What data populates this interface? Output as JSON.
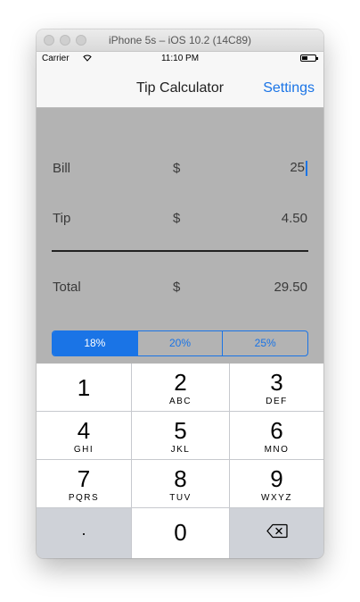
{
  "simulator": {
    "title": "iPhone 5s – iOS 10.2 (14C89)"
  },
  "status_bar": {
    "carrier": "Carrier",
    "wifi_icon": "wifi-icon",
    "time": "11:10 PM",
    "battery_icon": "battery-icon"
  },
  "nav": {
    "title": "Tip Calculator",
    "settings_label": "Settings"
  },
  "rows": {
    "bill": {
      "label": "Bill",
      "currency": "$",
      "value": "25"
    },
    "tip": {
      "label": "Tip",
      "currency": "$",
      "value": "4.50"
    },
    "total": {
      "label": "Total",
      "currency": "$",
      "value": "29.50"
    }
  },
  "tip_options": {
    "selected": "18%",
    "items": [
      "18%",
      "20%",
      "25%"
    ]
  },
  "keypad": {
    "keys": [
      {
        "digit": "1",
        "letters": ""
      },
      {
        "digit": "2",
        "letters": "ABC"
      },
      {
        "digit": "3",
        "letters": "DEF"
      },
      {
        "digit": "4",
        "letters": "GHI"
      },
      {
        "digit": "5",
        "letters": "JKL"
      },
      {
        "digit": "6",
        "letters": "MNO"
      },
      {
        "digit": "7",
        "letters": "PQRS"
      },
      {
        "digit": "8",
        "letters": "TUV"
      },
      {
        "digit": "9",
        "letters": "WXYZ"
      }
    ],
    "decimal": ".",
    "zero": "0",
    "backspace_icon": "backspace-icon"
  },
  "colors": {
    "accent": "#1a74e6",
    "content_bg": "#b3b3b3",
    "keypad_dark": "#cfd2d8"
  }
}
